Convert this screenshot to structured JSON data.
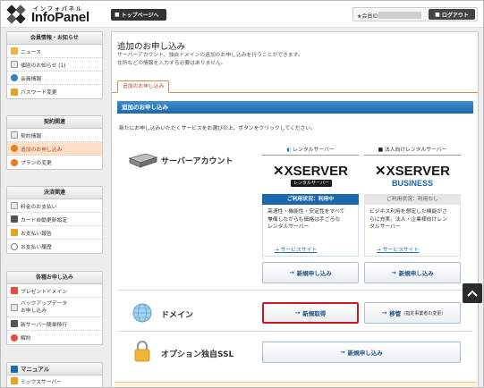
{
  "header": {
    "logo_sub": "インフォパネル",
    "logo_name": "InfoPanel",
    "top_button": "トップページへ",
    "member_label": "★会員ID",
    "logout": "ログアウト"
  },
  "sidebar": {
    "groups": [
      {
        "title": "会員情報・お知らせ",
        "items": [
          {
            "label": "ニュース"
          },
          {
            "label": "個別のお知らせ (1)"
          },
          {
            "label": "会員情報"
          },
          {
            "label": "パスワード変更"
          }
        ]
      },
      {
        "title": "契約関連",
        "items": [
          {
            "label": "契約情報"
          },
          {
            "label": "追加のお申し込み"
          },
          {
            "label": "プランの変更"
          }
        ]
      },
      {
        "title": "決済関連",
        "items": [
          {
            "label": "料金のお支払い"
          },
          {
            "label": "カード自動更新設定"
          },
          {
            "label": "お支払い報告"
          },
          {
            "label": "お支払い履歴"
          }
        ]
      },
      {
        "title": "各種お申し込み",
        "items": [
          {
            "label": "プレゼントドメイン"
          },
          {
            "label": "バックアップデータ"
          },
          {
            "label": "お申し込み"
          },
          {
            "label": "新サーバー簡単移行"
          },
          {
            "label": "解約"
          }
        ]
      }
    ],
    "manual_title": "マニュアル",
    "manual_first_item": "ミックスサーバー"
  },
  "main": {
    "title": "追加のお申し込み",
    "desc_line1": "サーバーアカウント、独自ドメインの追加のお申し込みを行うことができます。",
    "desc_line2": "住所などの情報を入力する必要はありません。",
    "tab": "追加のお申し込み",
    "section_title": "追加のお申し込み",
    "instruction": "新たにお申し込みいただくサービスをお選びの上、ボタンをクリックしてください。",
    "server": {
      "label": "サーバーアカウント",
      "col1_head": "レンタルサーバー",
      "col2_head": "法人向けレンタルサーバー",
      "col1_brand": "XSERVER",
      "col1_brand_sub": "レンタルサーバー",
      "col2_brand": "XSERVER",
      "col2_brand_sub": "BUSINESS",
      "col1_status": "ご利用状況：利用中",
      "col2_status": "ご利用状況：利用なし",
      "col1_desc_1": "高速性・機能性・安定性をすべて",
      "col1_desc_2": "兼備しながらも価格は手ごろな",
      "col1_desc_3": "レンタルサーバー",
      "col2_desc_1": "ビジネス利用を想定した機能がさ",
      "col2_desc_2": "らに充実。法人・企業様向けレン",
      "col2_desc_3": "タルサーバー",
      "col1_link": "サービスサイト",
      "col2_link": "サービスサイト",
      "col1_btn": "新規申し込み",
      "col2_btn": "新規申し込み"
    },
    "domain": {
      "label": "ドメイン",
      "btn_new": "新規取得",
      "btn_transfer": "移管",
      "btn_transfer_note": "(指定事業者の変更)"
    },
    "ssl": {
      "label": "オプション独自SSL",
      "btn": "新規申し込み"
    }
  },
  "colors": {
    "accent_blue": "#1d67ad",
    "active_bg": "#fde0c6",
    "highlight_red": "#d0161c"
  }
}
